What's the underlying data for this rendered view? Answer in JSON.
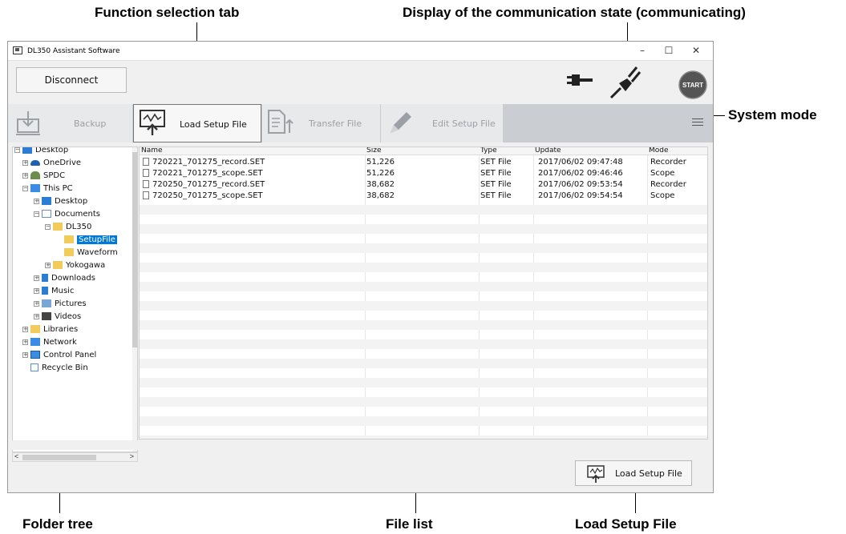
{
  "callouts": {
    "function_tab": "Function selection tab",
    "comm_state": "Display of the communication state (communicating)",
    "system_mode": "System mode",
    "folder_tree": "Folder tree",
    "file_list": "File list",
    "load_setup_file": "Load Setup File"
  },
  "window": {
    "title": "DL350 Assistant Software",
    "minimize": "–",
    "maximize": "☐",
    "close": "✕"
  },
  "toolbar": {
    "disconnect_label": "Disconnect",
    "start_label": "START"
  },
  "tabs": [
    {
      "label": "Backup",
      "icon": "backup-icon",
      "active": false
    },
    {
      "label": "Load Setup File",
      "icon": "load-setup-icon",
      "active": true
    },
    {
      "label": "Transfer File",
      "icon": "transfer-file-icon",
      "active": false
    },
    {
      "label": "Edit Setup File",
      "icon": "edit-pencil-icon",
      "active": false
    }
  ],
  "tree": {
    "items": [
      {
        "label": "Desktop",
        "icon": "desktop-icon"
      },
      {
        "label": "OneDrive",
        "icon": "onedrive-icon"
      },
      {
        "label": "SPDC",
        "icon": "user-icon"
      },
      {
        "label": "This PC",
        "icon": "pc-icon"
      },
      {
        "label": "Desktop",
        "icon": "desktop-icon"
      },
      {
        "label": "Documents",
        "icon": "documents-icon"
      },
      {
        "label": "DL350",
        "icon": "folder-icon"
      },
      {
        "label": "SetupFile",
        "icon": "folder-icon"
      },
      {
        "label": "Waveform",
        "icon": "folder-icon"
      },
      {
        "label": "Yokogawa",
        "icon": "folder-icon"
      },
      {
        "label": "Downloads",
        "icon": "downloads-icon"
      },
      {
        "label": "Music",
        "icon": "music-icon"
      },
      {
        "label": "Pictures",
        "icon": "pictures-icon"
      },
      {
        "label": "Videos",
        "icon": "videos-icon"
      },
      {
        "label": "Libraries",
        "icon": "libraries-icon"
      },
      {
        "label": "Network",
        "icon": "network-icon"
      },
      {
        "label": "Control Panel",
        "icon": "control-panel-icon"
      },
      {
        "label": "Recycle Bin",
        "icon": "recycle-bin-icon"
      }
    ]
  },
  "file_list": {
    "columns": [
      "Name",
      "Size",
      "Type",
      "Update",
      "Mode"
    ],
    "rows": [
      {
        "name": "720221_701275_record.SET",
        "size": "51,226",
        "type": "SET File",
        "update": "2017/06/02 09:47:48",
        "mode": "Recorder"
      },
      {
        "name": "720221_701275_scope.SET",
        "size": "51,226",
        "type": "SET File",
        "update": "2017/06/02 09:46:46",
        "mode": "Scope"
      },
      {
        "name": "720250_701275_record.SET",
        "size": "38,682",
        "type": "SET File",
        "update": "2017/06/02 09:53:54",
        "mode": "Recorder"
      },
      {
        "name": "720250_701275_scope.SET",
        "size": "38,682",
        "type": "SET File",
        "update": "2017/06/02 09:54:54",
        "mode": "Scope"
      }
    ]
  },
  "footer": {
    "load_button_label": "Load Setup File"
  },
  "colors": {
    "selection": "#0078d7",
    "tabbar": "#cacdd2",
    "start_button": "#555555"
  }
}
